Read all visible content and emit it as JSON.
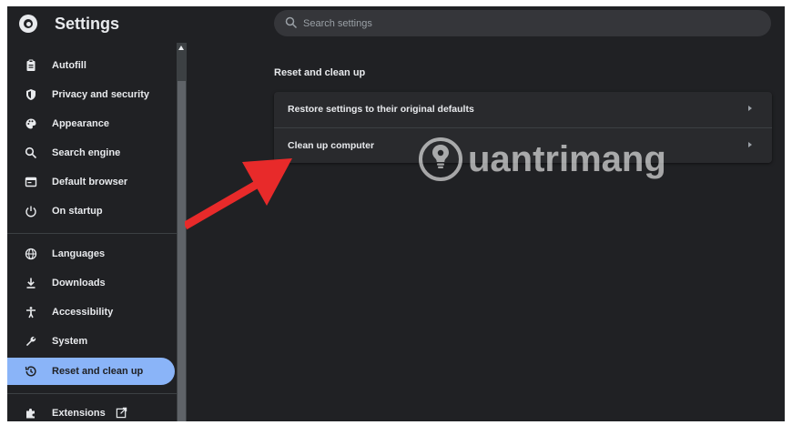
{
  "header": {
    "title": "Settings",
    "search_placeholder": "Search settings"
  },
  "sidebar": {
    "items": [
      {
        "label": "Autofill",
        "icon": "clipboard-icon"
      },
      {
        "label": "Privacy and security",
        "icon": "shield-icon"
      },
      {
        "label": "Appearance",
        "icon": "palette-icon"
      },
      {
        "label": "Search engine",
        "icon": "search-icon"
      },
      {
        "label": "Default browser",
        "icon": "browser-icon"
      },
      {
        "label": "On startup",
        "icon": "power-icon"
      },
      {
        "label": "Languages",
        "icon": "globe-icon"
      },
      {
        "label": "Downloads",
        "icon": "download-icon"
      },
      {
        "label": "Accessibility",
        "icon": "accessibility-icon"
      },
      {
        "label": "System",
        "icon": "wrench-icon"
      },
      {
        "label": "Reset and clean up",
        "icon": "history-icon",
        "active": true
      },
      {
        "label": "Extensions",
        "icon": "puzzle-icon"
      }
    ]
  },
  "main": {
    "section_title": "Reset and clean up",
    "rows": [
      {
        "label": "Restore settings to their original defaults"
      },
      {
        "label": "Clean up computer"
      }
    ]
  },
  "watermark": {
    "text": "uantrimang"
  },
  "colors": {
    "background": "#202124",
    "card": "#292a2d",
    "active_nav": "#8ab4f8",
    "text": "#e8eaed",
    "annotation_arrow": "#e82a2a"
  }
}
